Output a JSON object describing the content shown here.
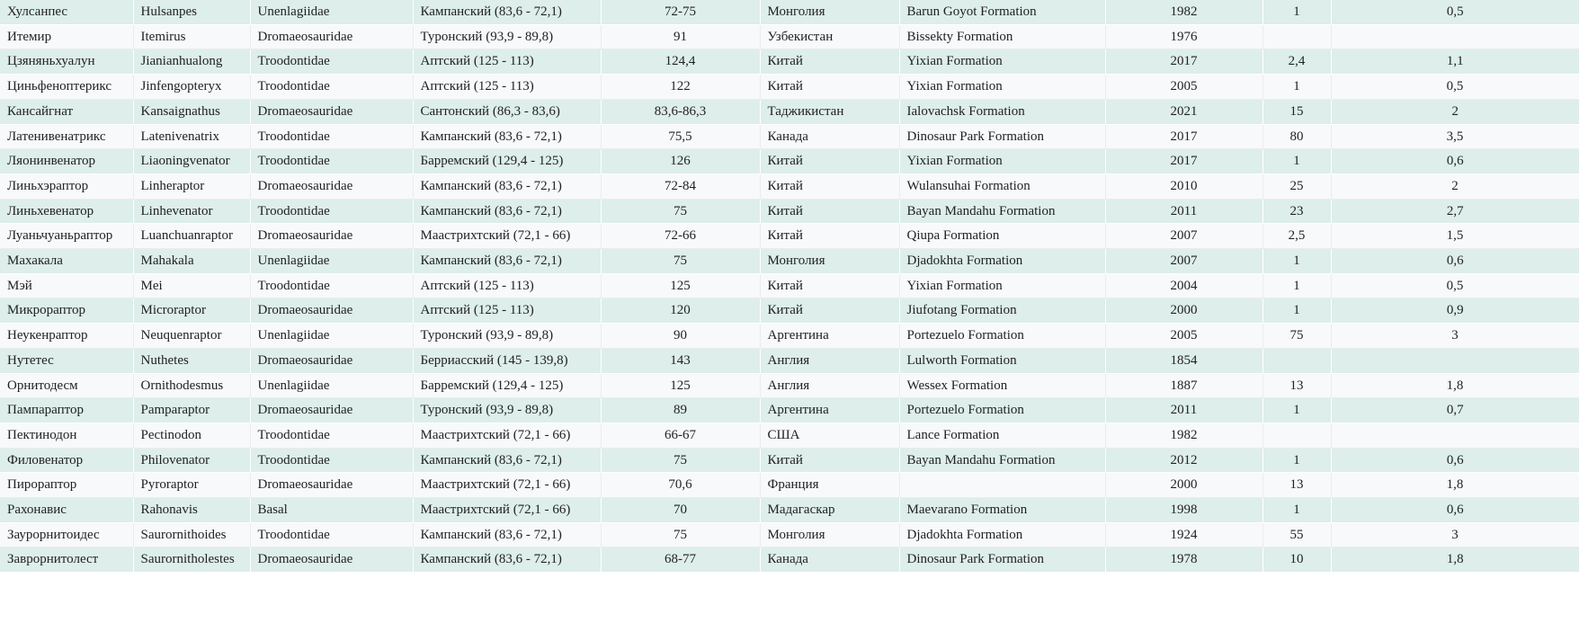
{
  "table": {
    "name": "dinosaur-taxa-table",
    "columns": [
      {
        "key": "ru_name",
        "align": "left",
        "name": "column-russian-name"
      },
      {
        "key": "latin",
        "align": "left",
        "name": "column-latin-name"
      },
      {
        "key": "family",
        "align": "left",
        "name": "column-family"
      },
      {
        "key": "stage",
        "align": "left",
        "name": "column-stage"
      },
      {
        "key": "age",
        "align": "center",
        "name": "column-age-mya"
      },
      {
        "key": "country",
        "align": "left",
        "name": "column-country"
      },
      {
        "key": "formation",
        "align": "left",
        "name": "column-formation"
      },
      {
        "key": "year",
        "align": "center",
        "name": "column-year"
      },
      {
        "key": "length",
        "align": "center",
        "name": "column-length"
      },
      {
        "key": "mass",
        "align": "center",
        "name": "column-mass"
      }
    ],
    "rows": [
      {
        "ru_name": "Хулсанпес",
        "latin": "Hulsanpes",
        "family": "Unenlagiidae",
        "stage": "Кампанский (83,6 - 72,1)",
        "age": "72-75",
        "country": "Монголия",
        "formation": "Barun Goyot Formation",
        "year": "1982",
        "length": "1",
        "mass": "0,5"
      },
      {
        "ru_name": "Итемир",
        "latin": "Itemirus",
        "family": "Dromaeosauridae",
        "stage": "Туронский (93,9 - 89,8)",
        "age": "91",
        "country": "Узбекистан",
        "formation": "Bissekty Formation",
        "year": "1976",
        "length": "",
        "mass": ""
      },
      {
        "ru_name": "Цзяняньхуалун",
        "latin": "Jianianhualong",
        "family": "Troodontidae",
        "stage": "Аптский (125 - 113)",
        "age": "124,4",
        "country": "Китай",
        "formation": "Yixian Formation",
        "year": "2017",
        "length": "2,4",
        "mass": "1,1"
      },
      {
        "ru_name": "Циньфеноптерикс",
        "latin": "Jinfengopteryx",
        "family": "Troodontidae",
        "stage": "Аптский (125 - 113)",
        "age": "122",
        "country": "Китай",
        "formation": "Yixian Formation",
        "year": "2005",
        "length": "1",
        "mass": "0,5"
      },
      {
        "ru_name": "Кансайгнат",
        "latin": "Kansaignathus",
        "family": "Dromaeosauridae",
        "stage": "Сантонский (86,3 - 83,6)",
        "age": "83,6-86,3",
        "country": "Таджикистан",
        "formation": "Ialovachsk Formation",
        "year": "2021",
        "length": "15",
        "mass": "2"
      },
      {
        "ru_name": "Латенивенатрикс",
        "latin": "Latenivenatrix",
        "family": "Troodontidae",
        "stage": "Кампанский (83,6 - 72,1)",
        "age": "75,5",
        "country": "Канада",
        "formation": "Dinosaur Park Formation",
        "year": "2017",
        "length": "80",
        "mass": "3,5"
      },
      {
        "ru_name": "Ляонинвенатор",
        "latin": "Liaoningvenator",
        "family": "Troodontidae",
        "stage": "Барремский (129,4 - 125)",
        "age": "126",
        "country": "Китай",
        "formation": "Yixian Formation",
        "year": "2017",
        "length": "1",
        "mass": "0,6"
      },
      {
        "ru_name": "Линьхэраптор",
        "latin": "Linheraptor",
        "family": "Dromaeosauridae",
        "stage": "Кампанский (83,6 - 72,1)",
        "age": "72-84",
        "country": "Китай",
        "formation": "Wulansuhai Formation",
        "year": "2010",
        "length": "25",
        "mass": "2"
      },
      {
        "ru_name": "Линьхевенатор",
        "latin": "Linhevenator",
        "family": "Troodontidae",
        "stage": "Кампанский (83,6 - 72,1)",
        "age": "75",
        "country": "Китай",
        "formation": "Bayan Mandahu Formation",
        "year": "2011",
        "length": "23",
        "mass": "2,7"
      },
      {
        "ru_name": "Луаньчуаньраптор",
        "latin": "Luanchuanraptor",
        "family": "Dromaeosauridae",
        "stage": "Маастрихтский (72,1 - 66)",
        "age": "72-66",
        "country": "Китай",
        "formation": "Qiupa Formation",
        "year": "2007",
        "length": "2,5",
        "mass": "1,5"
      },
      {
        "ru_name": "Махакала",
        "latin": "Mahakala",
        "family": "Unenlagiidae",
        "stage": "Кампанский (83,6 - 72,1)",
        "age": "75",
        "country": "Монголия",
        "formation": "Djadokhta Formation",
        "year": "2007",
        "length": "1",
        "mass": "0,6"
      },
      {
        "ru_name": "Мэй",
        "latin": "Mei",
        "family": "Troodontidae",
        "stage": "Аптский (125 - 113)",
        "age": "125",
        "country": "Китай",
        "formation": "Yixian Formation",
        "year": "2004",
        "length": "1",
        "mass": "0,5"
      },
      {
        "ru_name": "Микрораптор",
        "latin": "Microraptor",
        "family": "Dromaeosauridae",
        "stage": "Аптский (125 - 113)",
        "age": "120",
        "country": "Китай",
        "formation": "Jiufotang Formation",
        "year": "2000",
        "length": "1",
        "mass": "0,9"
      },
      {
        "ru_name": "Неукенраптор",
        "latin": "Neuquenraptor",
        "family": "Unenlagiidae",
        "stage": "Туронский (93,9 - 89,8)",
        "age": "90",
        "country": "Аргентина",
        "formation": "Portezuelo Formation",
        "year": "2005",
        "length": "75",
        "mass": "3"
      },
      {
        "ru_name": "Нутетес",
        "latin": "Nuthetes",
        "family": "Dromaeosauridae",
        "stage": "Берриасский (145 - 139,8)",
        "age": "143",
        "country": "Англия",
        "formation": "Lulworth Formation",
        "year": "1854",
        "length": "",
        "mass": ""
      },
      {
        "ru_name": "Орнитодесм",
        "latin": "Ornithodesmus",
        "family": "Unenlagiidae",
        "stage": "Барремский (129,4 - 125)",
        "age": "125",
        "country": "Англия",
        "formation": "Wessex Formation",
        "year": "1887",
        "length": "13",
        "mass": "1,8"
      },
      {
        "ru_name": "Пампараптор",
        "latin": "Pamparaptor",
        "family": "Dromaeosauridae",
        "stage": "Туронский (93,9 - 89,8)",
        "age": "89",
        "country": "Аргентина",
        "formation": "Portezuelo Formation",
        "year": "2011",
        "length": "1",
        "mass": "0,7"
      },
      {
        "ru_name": "Пектинодон",
        "latin": "Pectinodon",
        "family": "Troodontidae",
        "stage": "Маастрихтский (72,1 - 66)",
        "age": "66-67",
        "country": "США",
        "formation": "Lance Formation",
        "year": "1982",
        "length": "",
        "mass": ""
      },
      {
        "ru_name": "Филовенатор",
        "latin": "Philovenator",
        "family": "Troodontidae",
        "stage": "Кампанский (83,6 - 72,1)",
        "age": "75",
        "country": "Китай",
        "formation": "Bayan Mandahu Formation",
        "year": "2012",
        "length": "1",
        "mass": "0,6"
      },
      {
        "ru_name": "Пирораптор",
        "latin": "Pyroraptor",
        "family": "Dromaeosauridae",
        "stage": "Маастрихтский (72,1 - 66)",
        "age": "70,6",
        "country": "Франция",
        "formation": "",
        "year": "2000",
        "length": "13",
        "mass": "1,8"
      },
      {
        "ru_name": "Рахонавис",
        "latin": "Rahonavis",
        "family": "Basal",
        "stage": "Маастрихтский (72,1 - 66)",
        "age": "70",
        "country": "Мадагаскар",
        "formation": "Maevarano Formation",
        "year": "1998",
        "length": "1",
        "mass": "0,6"
      },
      {
        "ru_name": "Заурорнитоидес",
        "latin": "Saurornithoides",
        "family": "Troodontidae",
        "stage": "Кампанский (83,6 - 72,1)",
        "age": "75",
        "country": "Монголия",
        "formation": "Djadokhta Formation",
        "year": "1924",
        "length": "55",
        "mass": "3"
      },
      {
        "ru_name": "Заврорнитолест",
        "latin": "Saurornitholestes",
        "family": "Dromaeosauridae",
        "stage": "Кампанский (83,6 - 72,1)",
        "age": "68-77",
        "country": "Канада",
        "formation": "Dinosaur Park Formation",
        "year": "1978",
        "length": "10",
        "mass": "1,8"
      }
    ]
  },
  "colors": {
    "row_odd_background": "#ddeeeb",
    "row_even_background": "#f8f9fa",
    "text": "#222222",
    "page_background": "#ffffff"
  }
}
